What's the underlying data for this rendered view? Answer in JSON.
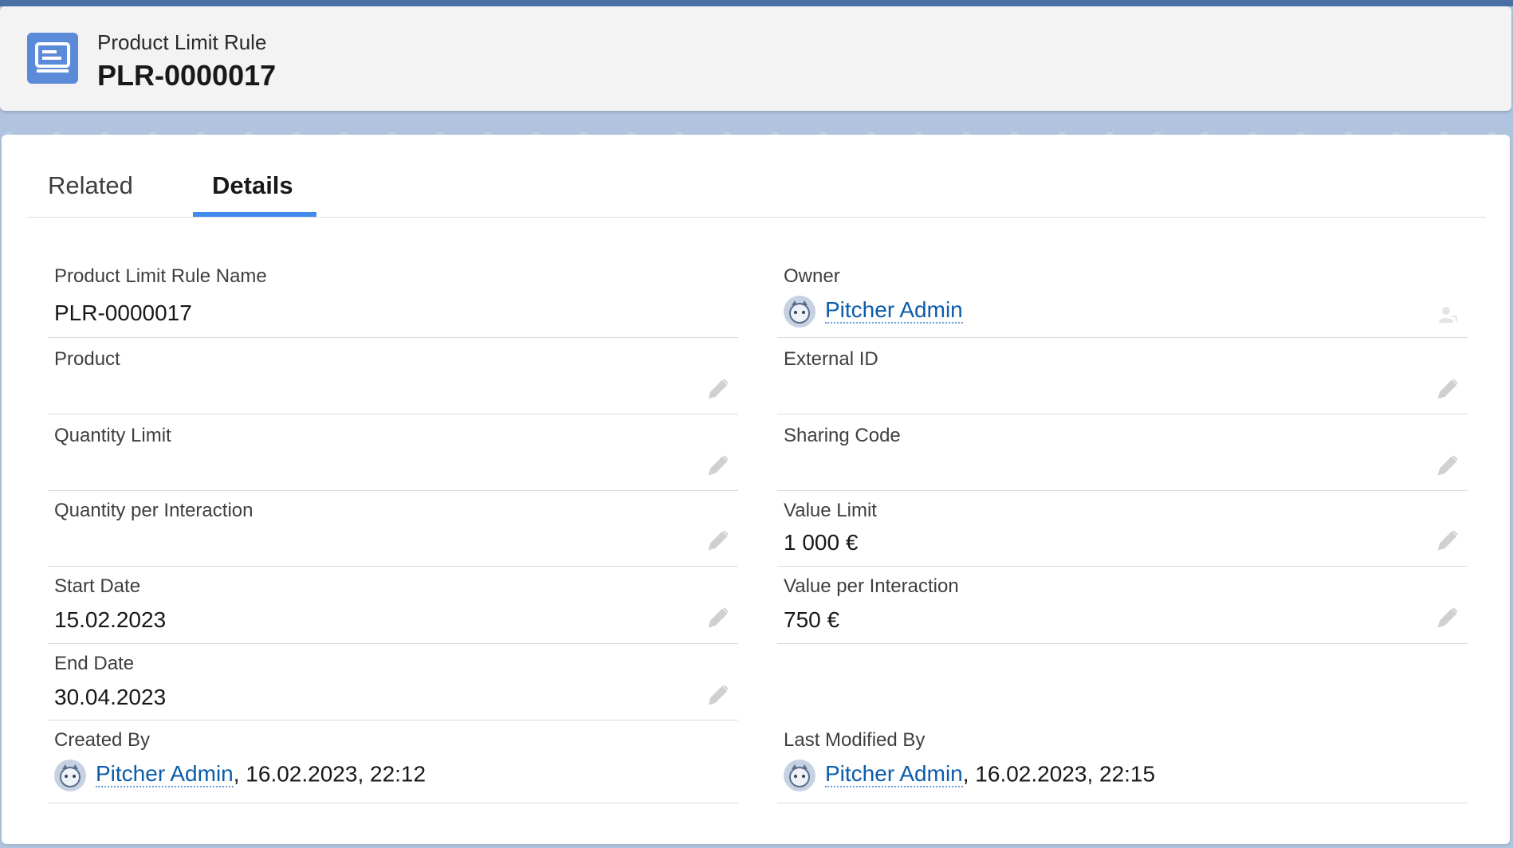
{
  "record": {
    "object_type": "Product Limit Rule",
    "name": "PLR-0000017"
  },
  "tabs": [
    {
      "label": "Related"
    },
    {
      "label": "Details"
    }
  ],
  "fields": {
    "name": {
      "label": "Product Limit Rule Name",
      "value": "PLR-0000017"
    },
    "owner": {
      "label": "Owner",
      "value": "Pitcher Admin"
    },
    "product": {
      "label": "Product",
      "value": ""
    },
    "external_id": {
      "label": "External ID",
      "value": ""
    },
    "quantity_limit": {
      "label": "Quantity Limit",
      "value": ""
    },
    "sharing_code": {
      "label": "Sharing Code",
      "value": ""
    },
    "quantity_per_interaction": {
      "label": "Quantity per Interaction",
      "value": ""
    },
    "value_limit": {
      "label": "Value Limit",
      "value": "1 000 €"
    },
    "start_date": {
      "label": "Start Date",
      "value": "15.02.2023"
    },
    "value_per_interaction": {
      "label": "Value per Interaction",
      "value": "750 €"
    },
    "end_date": {
      "label": "End Date",
      "value": "30.04.2023"
    },
    "created_by": {
      "label": "Created By",
      "user": "Pitcher Admin",
      "timestamp": ", 16.02.2023, 22:12"
    },
    "last_modified_by": {
      "label": "Last Modified By",
      "user": "Pitcher Admin",
      "timestamp": ", 16.02.2023, 22:15"
    }
  },
  "colors": {
    "accent": "#3f8cee",
    "link": "#0b5cab",
    "icon_bg": "#5b8bd8"
  },
  "icons": {
    "record_icon": "record-document-icon",
    "edit_icon": "pencil-icon",
    "change_owner_icon": "change-owner-icon",
    "avatar": "user-avatar-icon"
  }
}
